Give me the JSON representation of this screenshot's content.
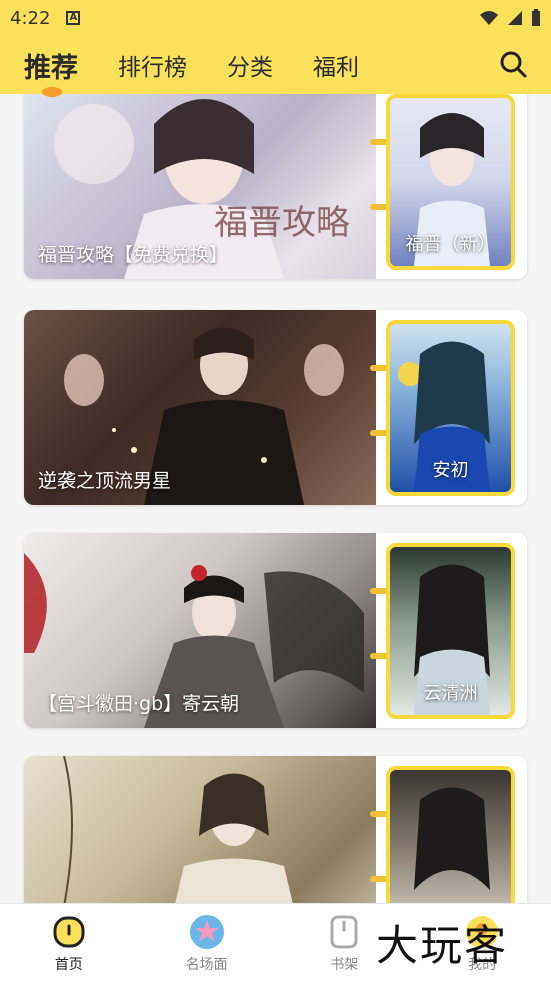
{
  "status": {
    "time": "4:22",
    "notice_badge": "A"
  },
  "nav": {
    "tabs": [
      "推荐",
      "排行榜",
      "分类",
      "福利"
    ]
  },
  "cards": [
    {
      "banner_title": "福晋攻略【免费兑换】",
      "thumb_title": "福晋（新）"
    },
    {
      "banner_title": "逆袭之顶流男星",
      "thumb_title": "安初"
    },
    {
      "banner_title": "【宫斗徽田·gb】寄云朝",
      "thumb_title": "云清洲"
    },
    {
      "banner_title": "",
      "thumb_title": ""
    }
  ],
  "bottom_nav": [
    {
      "label": "首页",
      "icon": "home-icon",
      "active": true
    },
    {
      "label": "名场面",
      "icon": "star-scene-icon",
      "active": false
    },
    {
      "label": "书架",
      "icon": "bookshelf-icon",
      "active": false
    },
    {
      "label": "我的",
      "icon": "profile-icon",
      "active": false
    }
  ],
  "watermark": "大玩客",
  "colors": {
    "topbar": "#fbe15a",
    "accent": "#f8d93a",
    "indicator": "#f59c2b"
  }
}
